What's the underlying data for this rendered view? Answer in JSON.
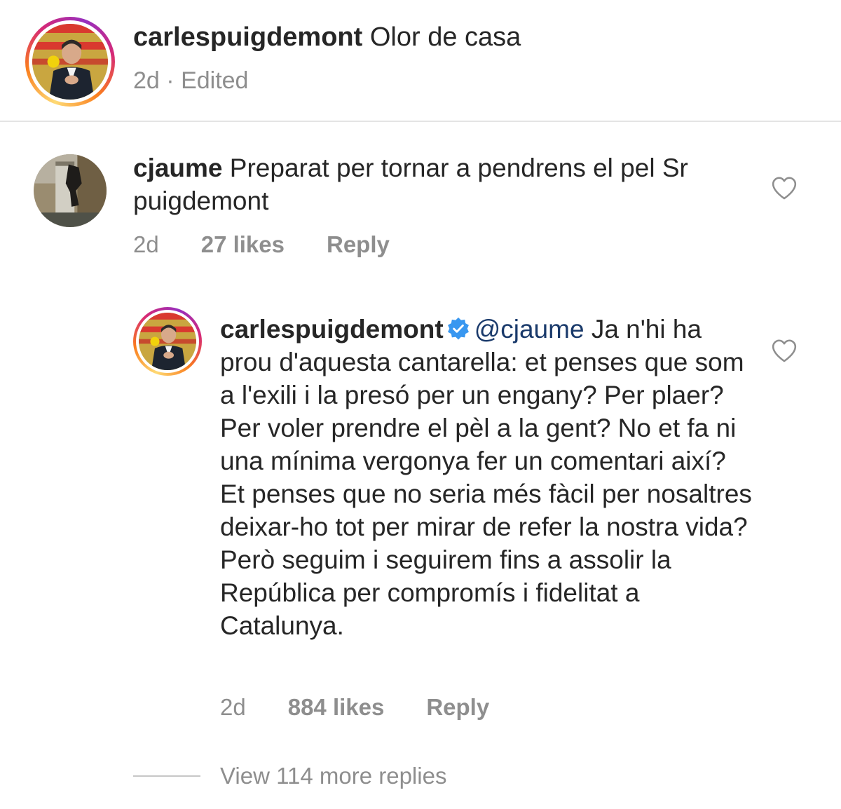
{
  "post": {
    "username": "carlespuigdemont",
    "caption": "Olor de casa",
    "time": "2d",
    "separator": "·",
    "edited": "Edited"
  },
  "comments": [
    {
      "username": "cjaume",
      "text": "Preparat per tornar a pendrens el pel Sr puigdemont",
      "time": "2d",
      "likes": "27 likes",
      "reply_label": "Reply"
    }
  ],
  "reply": {
    "username": "carlespuigdemont",
    "mention": "@cjaume",
    "text": "Ja n'hi ha prou d'aquesta cantarella: et penses que som a l'exili i la presó per un engany? Per plaer? Per voler prendre el pèl a la gent? No et fa ni una mínima vergonya fer un comentari així? Et penses que no seria més fàcil per nosaltres deixar-ho tot per mirar de refer la nostra vida? Però seguim i seguirem fins a assolir la República per compromís i fidelitat a Catalunya.",
    "time": "2d",
    "likes": "884 likes",
    "reply_label": "Reply"
  },
  "view_more": "View 114 more replies",
  "icons": {
    "heart": "heart-outline-icon",
    "verified": "verified-badge-icon"
  },
  "colors": {
    "verified": "#3897f0",
    "mention": "#1a3a6b",
    "muted": "#8e8e8e"
  }
}
